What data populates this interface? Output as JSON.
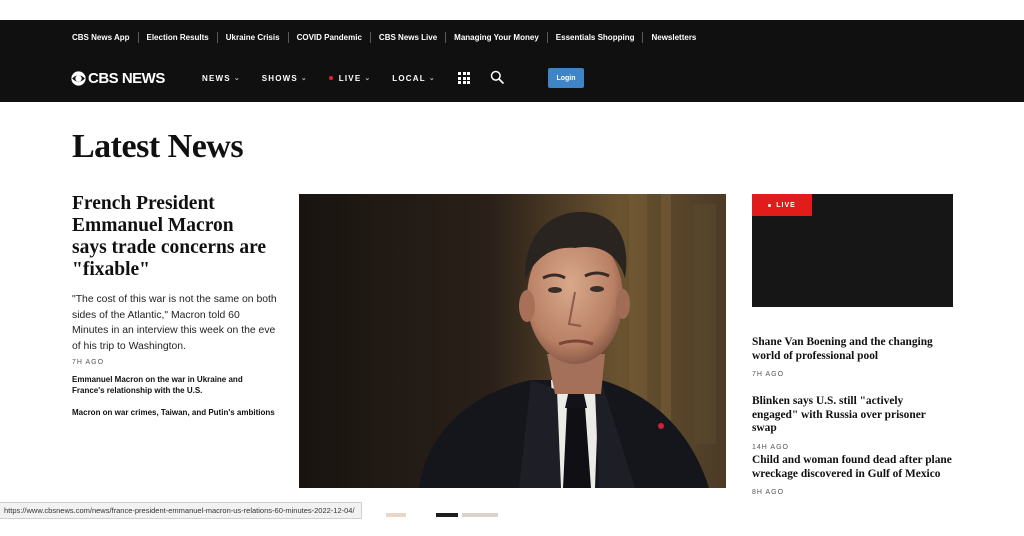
{
  "top_links": [
    "CBS News App",
    "Election Results",
    "Ukraine Crisis",
    "COVID Pandemic",
    "CBS News Live",
    "Managing Your Money",
    "Essentials Shopping",
    "Newsletters"
  ],
  "logo": {
    "text": "CBS NEWS",
    "icon": "cbs-eye-icon"
  },
  "nav": {
    "news": "NEWS",
    "shows": "SHOWS",
    "live": "LIVE",
    "local": "LOCAL"
  },
  "icons": {
    "grid": "grid-menu-icon",
    "search": "search-icon"
  },
  "login_label": "Login",
  "page_title": "Latest News",
  "lead": {
    "headline": "French President Emmanuel Macron says trade concerns are \"fixable\"",
    "summary": "\"The cost of this war is not the same on both sides of the Atlantic,\" Macron told 60 Minutes in an interview this week on the eve of his trip to Washington.",
    "time": "7H AGO",
    "related": [
      "Emmanuel Macron on the war in Ukraine and France's relationship with the U.S.",
      "Macron on war crimes, Taiwan, and Putin's ambitions"
    ]
  },
  "live_badge": "LIVE",
  "side_stories": [
    {
      "headline": "Shane Van Boening and the changing world of professional pool",
      "time": "7H AGO"
    },
    {
      "headline": "Blinken says U.S. still \"actively engaged\" with Russia over prisoner swap",
      "time": "14H AGO"
    },
    {
      "headline": "Child and woman found dead after plane wreckage discovered in Gulf of Mexico",
      "time": "8H AGO"
    }
  ],
  "status_url": "https://www.cbsnews.com/news/france-president-emmanuel-macron-us-relations-60-minutes-2022-12-04/",
  "colors": {
    "header_bg": "#101010",
    "live_red": "#e21b1b",
    "login_blue": "#3e84c6"
  }
}
